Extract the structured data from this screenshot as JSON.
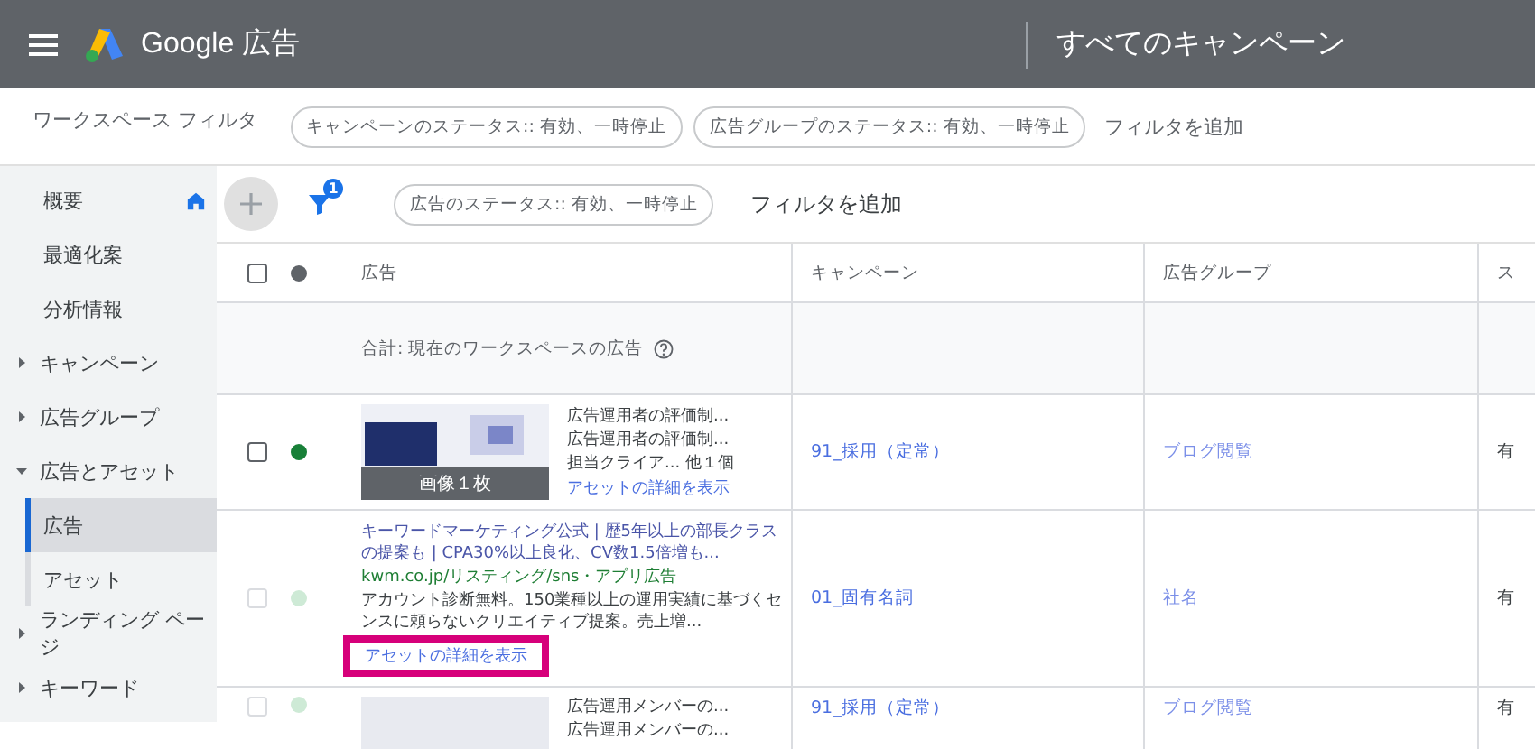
{
  "header": {
    "product": "Google 広告",
    "page_title": "すべてのキャンペーン"
  },
  "workspace_filter": {
    "label": "ワークスペース フィルタ",
    "chips": [
      "キャンペーンのステータス:: 有効、一時停止",
      "広告グループのステータス:: 有効、一時停止"
    ],
    "add_filter": "フィルタを追加"
  },
  "sidebar": {
    "items": [
      {
        "label": "概要",
        "selected": false
      },
      {
        "label": "最適化案",
        "selected": false
      },
      {
        "label": "分析情報",
        "selected": false
      },
      {
        "label": "キャンペーン",
        "selected": false,
        "expanded": false,
        "expandable": true
      },
      {
        "label": "広告グループ",
        "selected": false,
        "expanded": false,
        "expandable": true
      },
      {
        "label": "広告とアセット",
        "selected": false,
        "expanded": true,
        "expandable": true,
        "children": [
          {
            "label": "広告",
            "selected": true
          },
          {
            "label": "アセット",
            "selected": false
          }
        ]
      },
      {
        "label": "ランディング ページ",
        "selected": false,
        "expanded": false,
        "expandable": true
      },
      {
        "label": "キーワード",
        "selected": false,
        "expanded": false,
        "expandable": true
      }
    ]
  },
  "toolbar": {
    "filter_count": "1",
    "chips": [
      "広告のステータス:: 有効、一時停止"
    ],
    "add_filter": "フィルタを追加"
  },
  "table": {
    "select_all_checked": false,
    "columns": [
      "広告",
      "キャンペーン",
      "広告グループ",
      "ス"
    ],
    "summary": "合計: 現在のワークスペースの広告",
    "rows": [
      {
        "kind": "image",
        "enabled": true,
        "checked": false,
        "image_caption": "画像１枚",
        "lines": [
          "広告運用者の評価制...",
          "広告運用者の評価制...",
          "担当クライア...  他１個"
        ],
        "link": "アセットの詳細を表示",
        "highlighted": false,
        "campaign": "91_採用（定常）",
        "ad_group": "ブログ閲覧",
        "column_4": "有"
      },
      {
        "kind": "text",
        "enabled": false,
        "checked": false,
        "headline": "キーワードマーケティング公式 | 歴5年以上の部長クラスの提案も | CPA30%以上良化、CV数1.5倍増も...",
        "url": "kwm.co.jp/リスティング/sns・アプリ広告",
        "description": "アカウント診断無料。150業種以上の運用実績に基づくセンスに頼らないクリエイティブ提案。売上増...",
        "link": "アセットの詳細を表示",
        "highlighted": true,
        "campaign": "01_固有名詞",
        "ad_group": "社名",
        "column_4": "有"
      },
      {
        "kind": "photo",
        "enabled": false,
        "checked": false,
        "lines": [
          "広告運用メンバーの...",
          "広告運用メンバーの..."
        ],
        "campaign": "91_採用（定常）",
        "ad_group": "ブログ閲覧",
        "column_4": "有"
      }
    ]
  }
}
